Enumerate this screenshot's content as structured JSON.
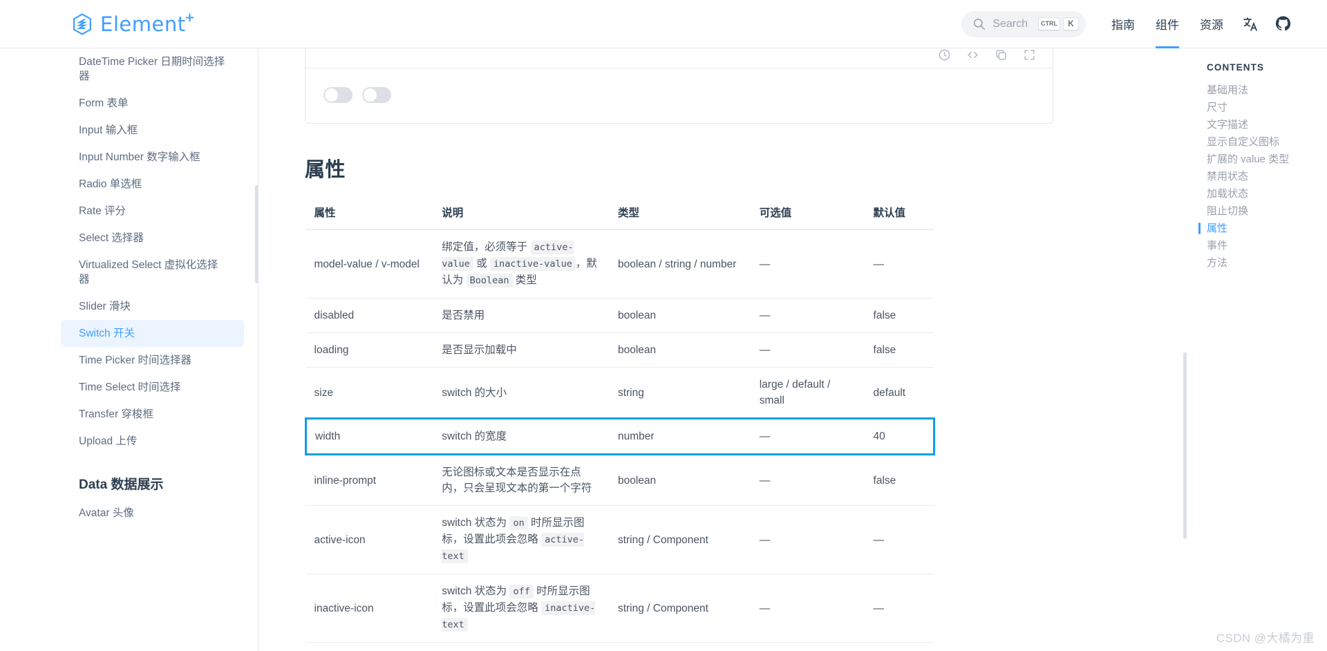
{
  "header": {
    "logo_text": "Element",
    "logo_plus": "+",
    "search": {
      "label": "Search",
      "kbd1": "CTRL",
      "kbd2": "K"
    },
    "nav": [
      {
        "label": "指南",
        "active": false
      },
      {
        "label": "组件",
        "active": true
      },
      {
        "label": "资源",
        "active": false
      }
    ],
    "lang_icon": "translate-icon",
    "github_icon": "github-icon"
  },
  "sidebar": {
    "items": [
      {
        "label": "DateTime Picker 日期时间选择器",
        "active": false
      },
      {
        "label": "Form 表单",
        "active": false
      },
      {
        "label": "Input 输入框",
        "active": false
      },
      {
        "label": "Input Number 数字输入框",
        "active": false
      },
      {
        "label": "Radio 单选框",
        "active": false
      },
      {
        "label": "Rate 评分",
        "active": false
      },
      {
        "label": "Select 选择器",
        "active": false
      },
      {
        "label": "Virtualized Select 虚拟化选择器",
        "active": false
      },
      {
        "label": "Slider 滑块",
        "active": false
      },
      {
        "label": "Switch 开关",
        "active": true
      },
      {
        "label": "Time Picker 时间选择器",
        "active": false
      },
      {
        "label": "Time Select 时间选择",
        "active": false
      },
      {
        "label": "Transfer 穿梭框",
        "active": false
      },
      {
        "label": "Upload 上传",
        "active": false
      }
    ],
    "group_title": "Data 数据展示",
    "group_items": [
      {
        "label": "Avatar 头像",
        "active": false
      }
    ]
  },
  "main": {
    "section_title": "属性",
    "table": {
      "headers": [
        "属性",
        "说明",
        "类型",
        "可选值",
        "默认值"
      ],
      "rows": [
        {
          "attr": "model-value / v-model",
          "desc_parts": [
            {
              "t": "绑定值，必须等于 ",
              "code": false
            },
            {
              "t": "active-value",
              "code": true
            },
            {
              "t": " 或 ",
              "code": false
            },
            {
              "t": "inactive-value",
              "code": true
            },
            {
              "t": "，默认为 ",
              "code": false
            },
            {
              "t": "Boolean",
              "code": true
            },
            {
              "t": " 类型",
              "code": false
            }
          ],
          "type": "boolean / string / number",
          "options": "—",
          "default": "—",
          "highlight": false
        },
        {
          "attr": "disabled",
          "desc_parts": [
            {
              "t": "是否禁用",
              "code": false
            }
          ],
          "type": "boolean",
          "options": "—",
          "default": "false",
          "highlight": false
        },
        {
          "attr": "loading",
          "desc_parts": [
            {
              "t": "是否显示加载中",
              "code": false
            }
          ],
          "type": "boolean",
          "options": "—",
          "default": "false",
          "highlight": false
        },
        {
          "attr": "size",
          "desc_parts": [
            {
              "t": "switch 的大小",
              "code": false
            }
          ],
          "type": "string",
          "options": "large / default / small",
          "default": "default",
          "highlight": false
        },
        {
          "attr": "width",
          "desc_parts": [
            {
              "t": "switch 的宽度",
              "code": false
            }
          ],
          "type": "number",
          "options": "—",
          "default": "40",
          "highlight": true
        },
        {
          "attr": "inline-prompt",
          "desc_parts": [
            {
              "t": "无论图标或文本是否显示在点内，只会呈现文本的第一个字符",
              "code": false
            }
          ],
          "type": "boolean",
          "options": "—",
          "default": "false",
          "highlight": false
        },
        {
          "attr": "active-icon",
          "desc_parts": [
            {
              "t": "switch 状态为 ",
              "code": false
            },
            {
              "t": "on",
              "code": true
            },
            {
              "t": " 时所显示图标，设置此项会忽略 ",
              "code": false
            },
            {
              "t": "active-text",
              "code": true
            }
          ],
          "type": "string / Component",
          "options": "—",
          "default": "—",
          "highlight": false
        },
        {
          "attr": "inactive-icon",
          "desc_parts": [
            {
              "t": "switch 状态为 ",
              "code": false
            },
            {
              "t": "off",
              "code": true
            },
            {
              "t": " 时所显示图标，设置此项会忽略 ",
              "code": false
            },
            {
              "t": "inactive-text",
              "code": true
            }
          ],
          "type": "string / Component",
          "options": "—",
          "default": "—",
          "highlight": false
        }
      ]
    },
    "demo": {
      "switch_count": 2,
      "toolbar_icons": [
        "clock-icon",
        "code-icon",
        "copy-icon",
        "expand-icon"
      ]
    }
  },
  "toc": {
    "title": "CONTENTS",
    "items": [
      {
        "label": "基础用法",
        "active": false
      },
      {
        "label": "尺寸",
        "active": false
      },
      {
        "label": "文字描述",
        "active": false
      },
      {
        "label": "显示自定义图标",
        "active": false
      },
      {
        "label": "扩展的 value 类型",
        "active": false
      },
      {
        "label": "禁用状态",
        "active": false
      },
      {
        "label": "加载状态",
        "active": false
      },
      {
        "label": "阻止切换",
        "active": false
      },
      {
        "label": "属性",
        "active": true
      },
      {
        "label": "事件",
        "active": false
      },
      {
        "label": "方法",
        "active": false
      }
    ]
  },
  "watermark": "CSDN @大橘为重",
  "colors": {
    "brand": "#409eff",
    "highlight_border": "#0ba0e3",
    "active_bg": "#ecf5ff",
    "text": "#2c3e50",
    "muted": "#9aa0aa"
  }
}
